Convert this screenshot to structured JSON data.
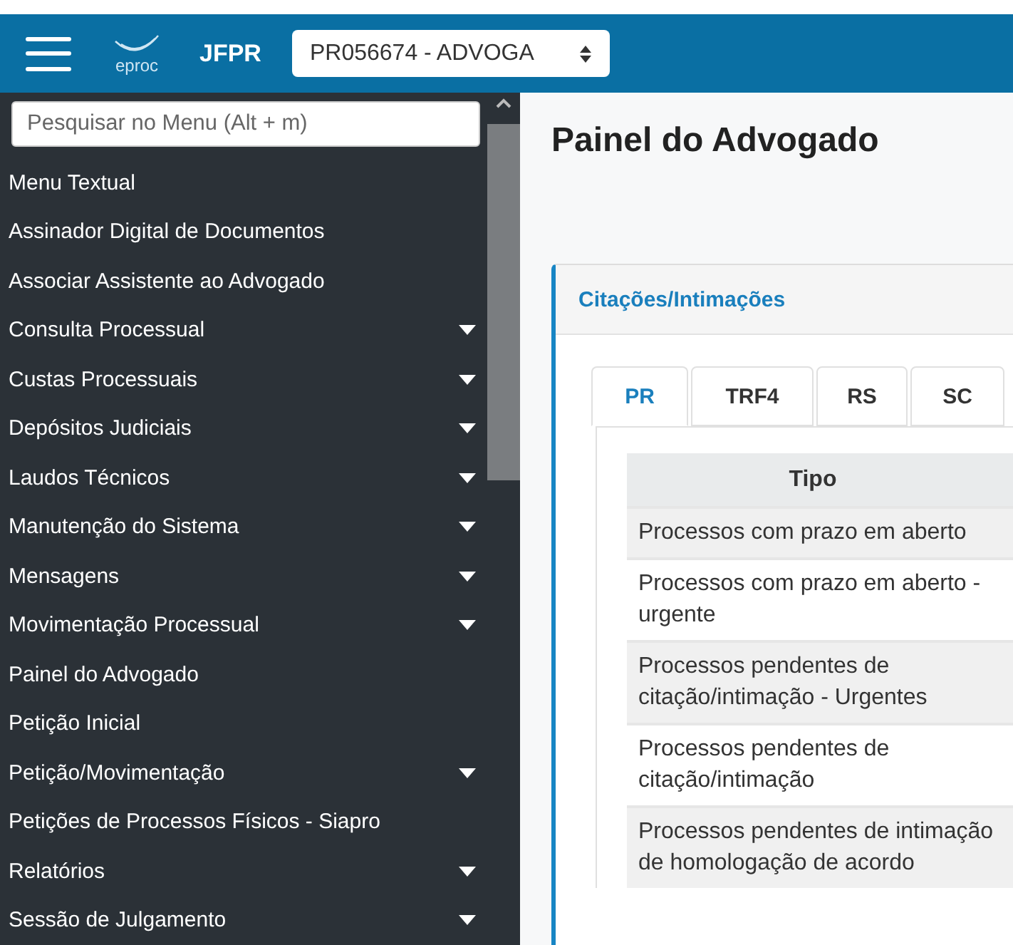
{
  "header": {
    "logo_text": "eproc",
    "section": "JFPR",
    "profile_select": "PR056674 - ADVOGA"
  },
  "sidebar": {
    "search": {
      "placeholder": "Pesquisar no Menu (Alt + m)"
    },
    "items": [
      {
        "label": "Menu Textual",
        "expandable": false
      },
      {
        "label": "Assinador Digital de Documentos",
        "expandable": false
      },
      {
        "label": "Associar Assistente ao Advogado",
        "expandable": false
      },
      {
        "label": "Consulta Processual",
        "expandable": true
      },
      {
        "label": "Custas Processuais",
        "expandable": true
      },
      {
        "label": "Depósitos Judiciais",
        "expandable": true
      },
      {
        "label": "Laudos Técnicos",
        "expandable": true
      },
      {
        "label": "Manutenção do Sistema",
        "expandable": true
      },
      {
        "label": "Mensagens",
        "expandable": true
      },
      {
        "label": "Movimentação Processual",
        "expandable": true
      },
      {
        "label": "Painel do Advogado",
        "expandable": false
      },
      {
        "label": "Petição Inicial",
        "expandable": false
      },
      {
        "label": "Petição/Movimentação",
        "expandable": true
      },
      {
        "label": "Petições de Processos Físicos - Siapro",
        "expandable": false
      },
      {
        "label": "Relatórios",
        "expandable": true
      },
      {
        "label": "Sessão de Julgamento",
        "expandable": true
      }
    ]
  },
  "page_title": "Painel do Advogado",
  "card": {
    "title": "Citações/Intimações",
    "tabs": [
      {
        "label": "PR",
        "selected": true
      },
      {
        "label": "TRF4",
        "selected": false
      },
      {
        "label": "RS",
        "selected": false
      },
      {
        "label": "SC",
        "selected": false
      }
    ],
    "table": {
      "columns": [
        "Tipo"
      ],
      "rows": [
        "Processos com prazo em aberto",
        "Processos com prazo em aberto - urgente",
        "Processos pendentes de citação/intimação - Urgentes",
        "Processos pendentes de citação/intimação",
        "Processos pendentes de intimação de homologação de acordo"
      ]
    }
  }
}
